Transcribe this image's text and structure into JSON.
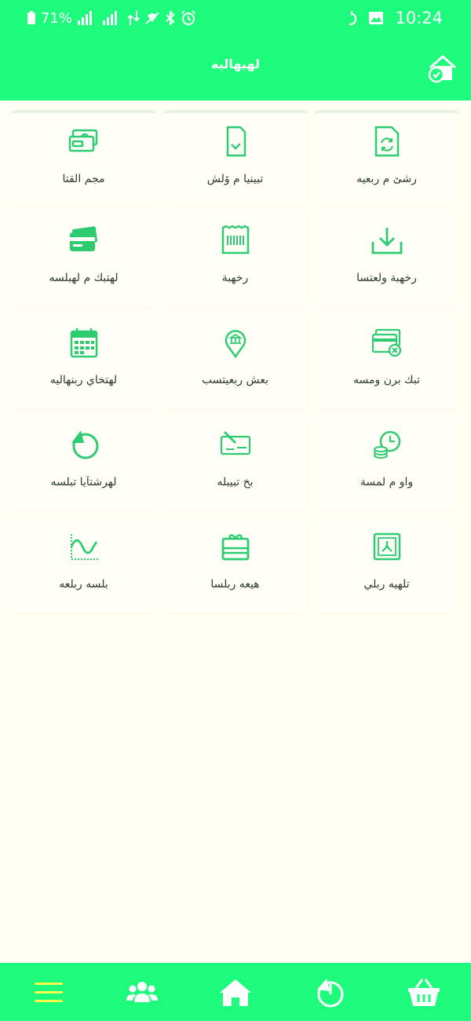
{
  "status_bar": {
    "time": "10:24",
    "battery": "71%"
  },
  "header": {
    "title": "لهيهاليه"
  },
  "tiles": [
    {
      "label": "مجم القتا",
      "icon": "cash-icon"
    },
    {
      "label": "تبينيا م ۆلش",
      "icon": "document-check-icon"
    },
    {
      "label": "رشێ م ربعيه",
      "icon": "document-refresh-icon"
    },
    {
      "label": "لهتبك م لهبلسه",
      "icon": "credit-card-icon"
    },
    {
      "label": "رخهبة",
      "icon": "receipt-icon"
    },
    {
      "label": "رخهبة ولعتسا",
      "icon": "download-icon"
    },
    {
      "label": "لهتخاي ربنهاليه",
      "icon": "calendar-icon"
    },
    {
      "label": "بعش ربعيتسب",
      "icon": "bank-location-icon"
    },
    {
      "label": "تبك برن ومسه",
      "icon": "card-cancel-icon"
    },
    {
      "label": "لهرشتآيا تبلسه",
      "icon": "pie-chart-icon"
    },
    {
      "label": "بخ تبيبله",
      "icon": "cheque-icon"
    },
    {
      "label": "واو م لمسة",
      "icon": "coins-clock-icon"
    },
    {
      "label": "بلسه ربلعه",
      "icon": "wave-chart-icon"
    },
    {
      "label": "هيعه ربلسا",
      "icon": "gift-card-icon"
    },
    {
      "label": "تلهيه ربلي",
      "icon": "safe-icon"
    }
  ],
  "colors": {
    "accent": "#1DFB7C",
    "background": "#FEFEF2",
    "menu_icon": "#F6F84A"
  }
}
